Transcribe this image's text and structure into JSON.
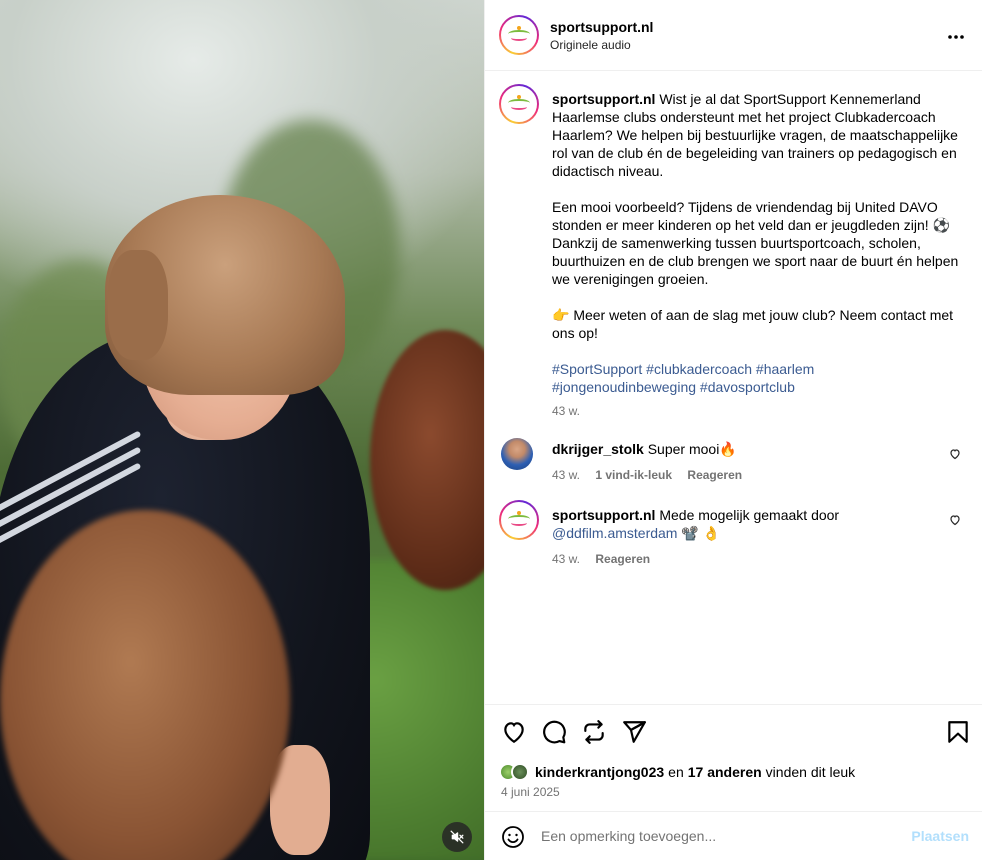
{
  "media": {
    "mute_icon": "speaker-muted-icon"
  },
  "header": {
    "username": "sportsupport.nl",
    "audio": "Originele audio",
    "more_icon": "more-horizontal-icon"
  },
  "caption": {
    "username": "sportsupport.nl",
    "paragraph1": "Wist je al dat SportSupport Kennemerland Haarlemse clubs ondersteunt met het project Clubkadercoach Haarlem? We helpen bij bestuurlijke vragen, de maatschappelijke rol van de club én de begeleiding van trainers op pedagogisch en didactisch niveau.",
    "paragraph2": "Een mooi voorbeeld? Tijdens de vriendendag bij United DAVO stonden er meer kinderen op het veld dan er jeugdleden zijn! ⚽ Dankzij de samenwerking tussen buurtsportcoach, scholen, buurthuizen en de club brengen we sport naar de buurt én helpen we verenigingen groeien.",
    "paragraph3": "👉 Meer weten of aan de slag met jouw club? Neem contact met ons op!",
    "hashtags_line1": "#SportSupport #clubkadercoach #haarlem",
    "hashtags_line2": "#jongenoudinbeweging #davosportclub",
    "time": "43 w."
  },
  "comments": [
    {
      "username": "dkrijger_stolk",
      "text": "Super mooi🔥",
      "time": "43 w.",
      "likes": "1 vind-ik-leuk",
      "reply": "Reageren"
    },
    {
      "username": "sportsupport.nl",
      "text": "Mede mogelijk gemaakt door",
      "mention": "@ddfilm.amsterdam",
      "emoji": "📽️ 👌",
      "time": "43 w.",
      "reply": "Reageren"
    }
  ],
  "actions": {
    "like_icon": "heart-icon",
    "comment_icon": "comment-icon",
    "share_icon": "repost-icon",
    "send_icon": "send-icon",
    "save_icon": "bookmark-icon"
  },
  "likes": {
    "user": "kinderkrantjong023",
    "connector": "en",
    "others": "17 anderen",
    "suffix": "vinden dit leuk"
  },
  "date": "4 juni 2025",
  "comment_box": {
    "placeholder": "Een opmerking toevoegen...",
    "post_label": "Plaatsen",
    "emoji_icon": "emoji-icon"
  }
}
